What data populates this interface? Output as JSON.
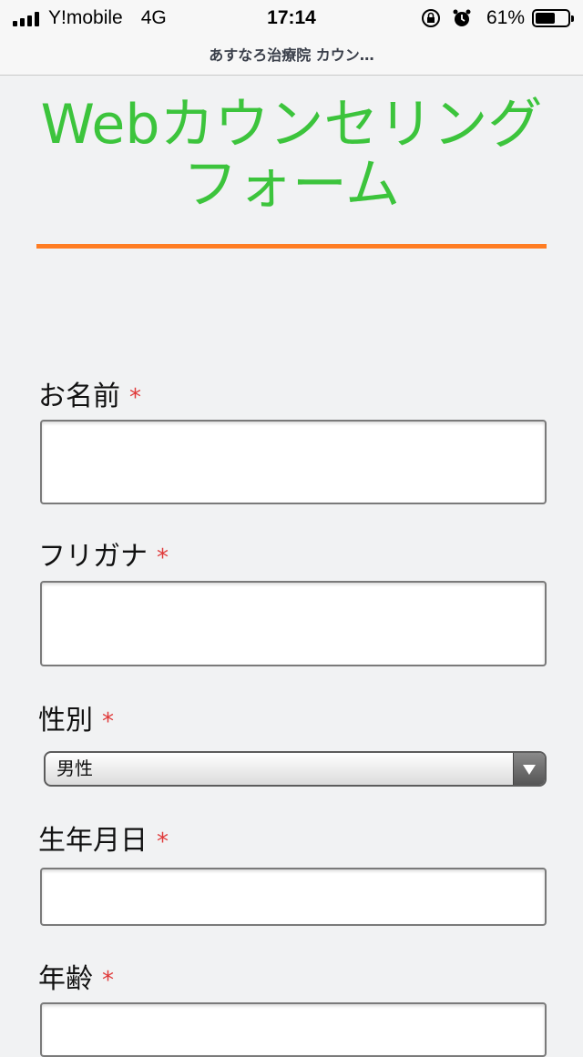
{
  "status_bar": {
    "carrier": "Y!mobile",
    "network": "4G",
    "time": "17:14",
    "battery_percent": "61%",
    "battery_level": 0.61
  },
  "browser": {
    "page_title": "あすなろ治療院 カウン…"
  },
  "form": {
    "title_line1": "Webカウンセリング",
    "title_line2": "フォーム",
    "required_mark": "*",
    "fields": [
      {
        "label": "お名前",
        "value": ""
      },
      {
        "label": "フリガナ",
        "value": ""
      },
      {
        "label": "性別",
        "selected": "男性"
      },
      {
        "label": "生年月日",
        "value": ""
      },
      {
        "label": "年齢",
        "value": ""
      }
    ]
  },
  "colors": {
    "title": "#3cc43c",
    "divider": "#ff7d23",
    "required": "#e03a3a"
  }
}
